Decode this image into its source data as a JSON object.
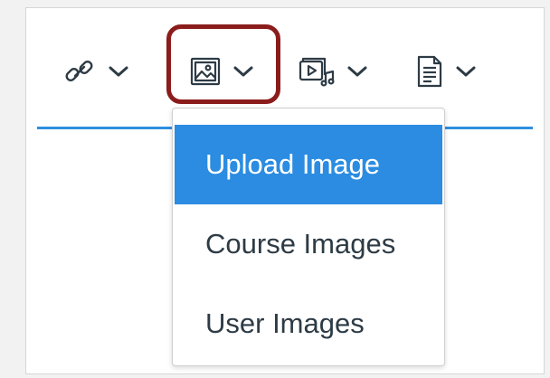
{
  "toolbar": {
    "tools": [
      {
        "name": "link",
        "icon": "link-icon"
      },
      {
        "name": "image",
        "icon": "image-icon",
        "highlighted": true
      },
      {
        "name": "media",
        "icon": "media-icon"
      },
      {
        "name": "document",
        "icon": "document-icon"
      }
    ],
    "highlight_color": "#8b1c1c",
    "divider_color": "#2f8fe0"
  },
  "dropdown": {
    "items": [
      {
        "label": "Upload Image",
        "active": true
      },
      {
        "label": "Course Images",
        "active": false
      },
      {
        "label": "User Images",
        "active": false
      }
    ],
    "active_color": "#2b8ce1"
  }
}
